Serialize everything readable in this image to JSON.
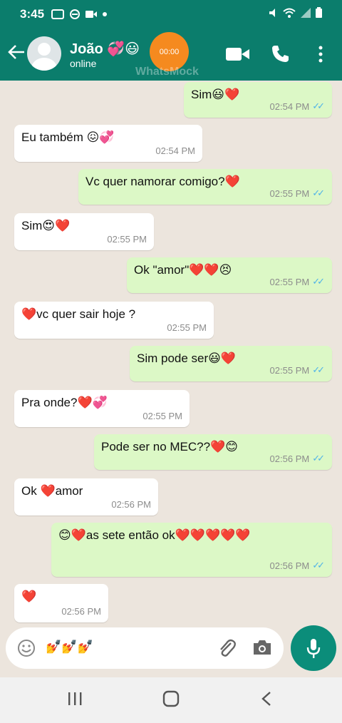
{
  "status_bar": {
    "time": "3:45"
  },
  "header": {
    "contact_name": "João 💞😃",
    "contact_status": "online",
    "call_timer": "00:00",
    "watermark": "WhatsMock"
  },
  "messages": [
    {
      "side": "out",
      "text": "Sim😃❤️",
      "time": "02:54 PM"
    },
    {
      "side": "in",
      "text": "Eu também 😖💞",
      "time": "02:54 PM"
    },
    {
      "side": "out",
      "text": "Vc quer namorar comigo?❤️",
      "time": "02:55 PM"
    },
    {
      "side": "in",
      "text": "Sim😍❤️",
      "time": "02:55 PM"
    },
    {
      "side": "out",
      "text": "Ok \"amor\"❤️❤️😣",
      "time": "02:55 PM"
    },
    {
      "side": "in",
      "text": "❤️vc quer sair hoje ?",
      "time": "02:55 PM"
    },
    {
      "side": "out",
      "text": "Sim pode ser😃❤️",
      "time": "02:55 PM"
    },
    {
      "side": "in",
      "text": "Pra onde?❤️💞",
      "time": "02:55 PM"
    },
    {
      "side": "out",
      "text": "Pode ser no MEC??❤️😊",
      "time": "02:56 PM"
    },
    {
      "side": "in",
      "text": "Ok ❤️amor",
      "time": "02:56 PM"
    },
    {
      "side": "out",
      "text": "😊❤️as sete então ok❤️❤️❤️❤️❤️",
      "time": "02:56 PM"
    },
    {
      "side": "in",
      "text": "❤️",
      "time": "02:56 PM"
    }
  ],
  "input": {
    "value": "💅💅💅"
  },
  "colors": {
    "header": "#0b7d6c",
    "outgoing_bubble": "#dcf8c6",
    "incoming_bubble": "#ffffff",
    "read_ticks": "#4fb3e8",
    "mic_button": "#0b8d7a",
    "call_timer": "#f58a1f"
  }
}
